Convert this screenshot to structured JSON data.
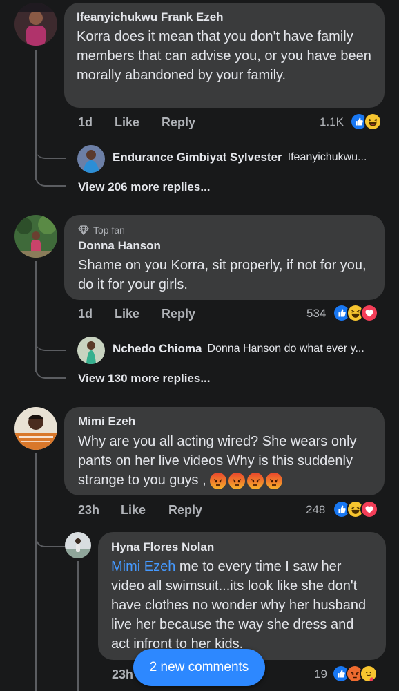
{
  "comments": [
    {
      "author": "Ifeanyichukwu Frank Ezeh",
      "text": "Korra does it mean that you don't have family members that can advise you, or you have been morally abandoned by your family.",
      "time": "1d",
      "like": "Like",
      "reply": "Reply",
      "reaction_count": "1.1K",
      "reactions": [
        "like",
        "haha"
      ],
      "reply_preview": {
        "author": "Endurance Gimbiyat Sylvester",
        "text": "Ifeanyichukwu..."
      },
      "view_more": "View 206 more replies..."
    },
    {
      "badge": "Top fan",
      "author": "Donna Hanson",
      "text": "Shame on you Korra, sit properly,  if not for you, do it for your girls.",
      "time": "1d",
      "like": "Like",
      "reply": "Reply",
      "reaction_count": "534",
      "reactions": [
        "like",
        "haha",
        "love"
      ],
      "reply_preview": {
        "author": "Nchedo Chioma",
        "text": "Donna Hanson do what ever y..."
      },
      "view_more": "View 130 more replies..."
    },
    {
      "author": "Mimi Ezeh",
      "text": "Why are you all acting wired? She wears only pants on her live videos Why is this suddenly strange to you guys ,",
      "emoji_inline": [
        "angry",
        "angry",
        "angry",
        "angry"
      ],
      "time": "23h",
      "like": "Like",
      "reply": "Reply",
      "reaction_count": "248",
      "reactions": [
        "like",
        "haha",
        "love"
      ]
    },
    {
      "author": "Hyna Flores Nolan",
      "mention": "Mimi Ezeh",
      "text": " me to every time I saw her video all swimsuit...its look like she don't have clothes no wonder why her husband live her because the way she dress and act infront to her kids.",
      "time": "23h",
      "reaction_count": "19",
      "reactions": [
        "like",
        "angry",
        "care"
      ]
    }
  ],
  "new_comments_button": "2 new comments",
  "colors": {
    "background": "#18191a",
    "bubble": "#3a3b3c",
    "accent": "#2d88ff",
    "mention": "#4599ff",
    "secondary_text": "#b0b3b8"
  }
}
